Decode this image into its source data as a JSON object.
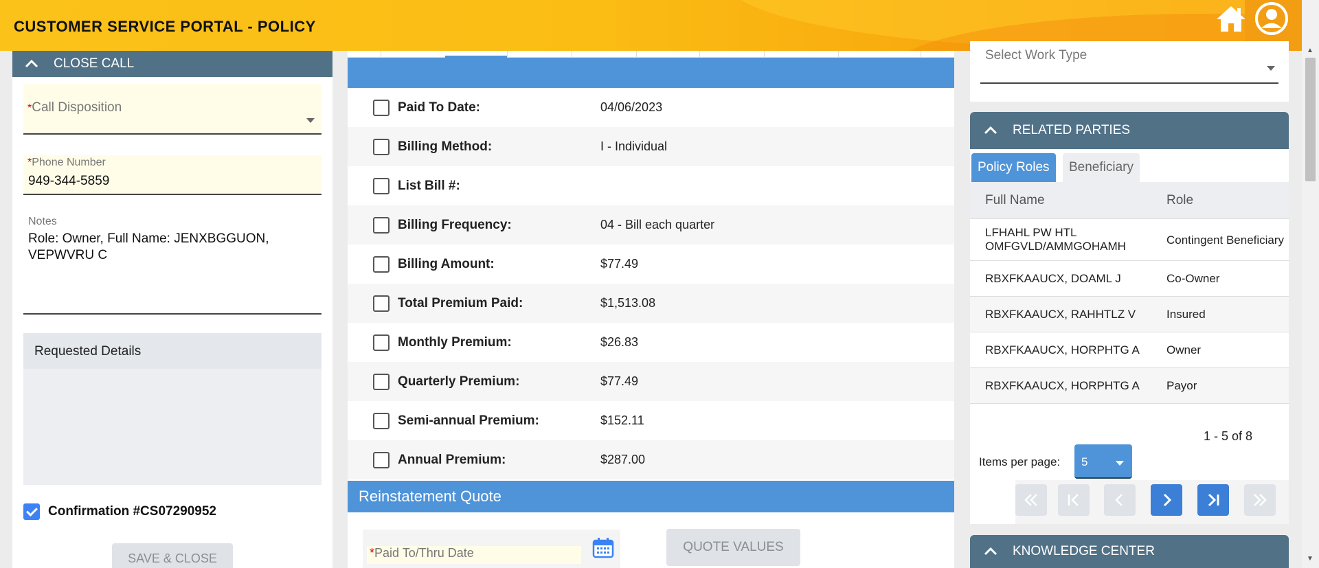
{
  "header": {
    "title": "CUSTOMER SERVICE PORTAL - POLICY"
  },
  "close_call": {
    "title": "CLOSE CALL",
    "call_disposition": {
      "label": "Call Disposition",
      "required": "*"
    },
    "phone_number": {
      "label": "Phone Number",
      "required": "*",
      "value": "949-344-5859"
    },
    "notes": {
      "label": "Notes",
      "value": "Role: Owner, Full Name: JENXBGGUON, VEPWVRU C"
    },
    "requested_details": {
      "label": "Requested Details"
    },
    "confirmation": {
      "label": "Confirmation #CS07290952",
      "checked": true
    },
    "save_button": "SAVE & CLOSE"
  },
  "billing": {
    "rows": [
      {
        "label": "Paid To Date:",
        "value": "04/06/2023"
      },
      {
        "label": "Billing Method:",
        "value": "I - Individual"
      },
      {
        "label": "List Bill #:",
        "value": ""
      },
      {
        "label": "Billing Frequency:",
        "value": "04 - Bill each quarter"
      },
      {
        "label": "Billing Amount:",
        "value": "$77.49"
      },
      {
        "label": "Total Premium Paid:",
        "value": "$1,513.08"
      },
      {
        "label": "Monthly Premium:",
        "value": "$26.83"
      },
      {
        "label": "Quarterly Premium:",
        "value": "$77.49"
      },
      {
        "label": "Semi-annual Premium:",
        "value": "$152.11"
      },
      {
        "label": "Annual Premium:",
        "value": "$287.00"
      }
    ]
  },
  "reinstatement": {
    "title": "Reinstatement Quote",
    "paid_thru": {
      "label": "Paid To/Thru Date",
      "required": "*"
    },
    "quote_button": "QUOTE VALUES"
  },
  "work_type": {
    "placeholder": "Select Work Type"
  },
  "related_parties": {
    "title": "RELATED PARTIES",
    "tabs": [
      "Policy Roles",
      "Beneficiary"
    ],
    "columns": [
      "Full Name",
      "Role"
    ],
    "rows": [
      {
        "name": "LFHAHL PW HTL OMFGVLD/AMMGOHAMH",
        "role": "Contingent Beneficiary"
      },
      {
        "name": "RBXFKAAUCX, DOAML J",
        "role": "Co-Owner"
      },
      {
        "name": "RBXFKAAUCX, RAHHTLZ V",
        "role": "Insured"
      },
      {
        "name": "RBXFKAAUCX, HORPHTG A",
        "role": "Owner"
      },
      {
        "name": "RBXFKAAUCX, HORPHTG A",
        "role": "Payor"
      }
    ],
    "range": "1 - 5 of 8",
    "items_per_page_label": "Items per page:",
    "items_per_page": "5"
  },
  "knowledge_center": {
    "title": "KNOWLEDGE CENTER"
  },
  "colors": {
    "header": "#fbc21a",
    "panel_head": "#517187",
    "accent_blue": "#4f94d9"
  }
}
